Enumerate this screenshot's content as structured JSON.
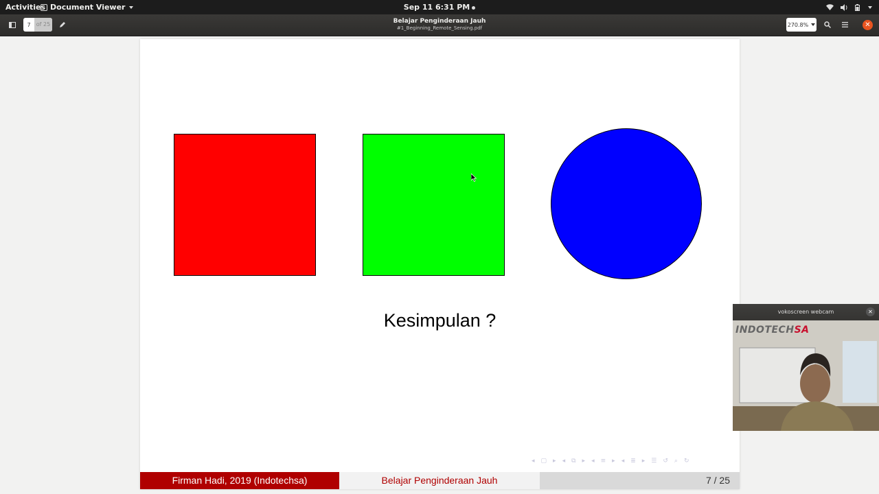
{
  "topbar": {
    "activities": "Activities",
    "app_name": "Document Viewer",
    "clock": "Sep 11   6:31 PM",
    "icons": [
      "wifi-icon",
      "volume-icon",
      "battery-icon"
    ]
  },
  "toolbar": {
    "page_current": "7",
    "page_of": "of 25",
    "doc_title": "Belajar Penginderaan Jauh",
    "doc_file": "#1_Beginning_Remote_Sensing.pdf",
    "zoom": "270.8%"
  },
  "slide": {
    "text": "Kesimpulan ?",
    "shapes": [
      {
        "name": "red-square",
        "color": "#ff0000"
      },
      {
        "name": "green-square",
        "color": "#00ff00"
      },
      {
        "name": "blue-circle",
        "color": "#0000ff"
      }
    ],
    "footer": {
      "author": "Firman Hadi, 2019  (Indotechsa)",
      "title": "Belajar Penginderaan Jauh",
      "page": "7 / 25"
    }
  },
  "webcam": {
    "title": "vokoscreen webcam",
    "logo_main": "INDOTECH",
    "logo_accent": "SA"
  },
  "colors": {
    "accent_orange": "#e95420",
    "footer_red": "#b00000"
  }
}
